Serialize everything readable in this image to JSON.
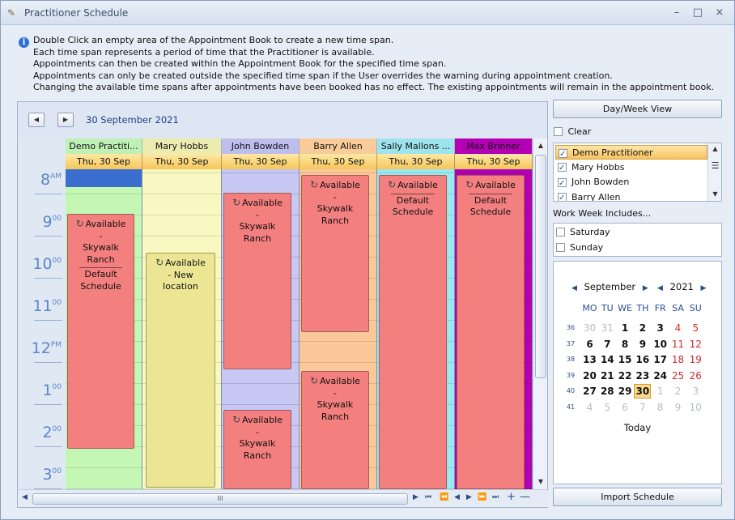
{
  "window": {
    "title": "Practitioner Schedule",
    "controls": [
      "–",
      "□",
      "×"
    ]
  },
  "info": {
    "lines": [
      "Double Click an empty area of the Appointment Book to create a new time span.",
      "Each time span represents a period of time that the Practitioner is available.",
      "Appointments can then be created within the Appointment Book for the specified time span.",
      "Appointments can only be created outside the specified time span if the User overrides the warning during appointment creation.",
      "Changing the available time spans after appointments have been booked has no effect.  The existing appointments will remain in the appointment book."
    ]
  },
  "book": {
    "date": "30 September 2021",
    "times": [
      {
        "h": "8",
        "m": "AM"
      },
      {
        "h": "9",
        "m": "00"
      },
      {
        "h": "10",
        "m": "00"
      },
      {
        "h": "11",
        "m": "00"
      },
      {
        "h": "12",
        "m": "PM"
      },
      {
        "h": "1",
        "m": "00"
      },
      {
        "h": "2",
        "m": "00"
      },
      {
        "h": "3",
        "m": "00"
      }
    ],
    "columns": [
      {
        "name": "Demo Practiti...",
        "date": "Thu, 30 Sep",
        "head_color": "#bff0b4",
        "body_color": "#c4f6b4",
        "line_color": "#a9dc9c",
        "busy_color": "#3a6fd0"
      },
      {
        "name": "Mary Hobbs",
        "date": "Thu, 30 Sep",
        "head_color": "#ecebb0",
        "body_color": "#faf8c2",
        "line_color": "#dedba0",
        "busy_color": ""
      },
      {
        "name": "John Bowden",
        "date": "Thu, 30 Sep",
        "head_color": "#bdbdee",
        "body_color": "#c8c8f4",
        "line_color": "#a9a9dc",
        "busy_color": ""
      },
      {
        "name": "Barry Allen",
        "date": "Thu, 30 Sep",
        "head_color": "#f9cb98",
        "body_color": "#fbc89a",
        "line_color": "#e3b083",
        "busy_color": ""
      },
      {
        "name": "Sally  Mallons ...",
        "date": "Thu, 30 Sep",
        "head_color": "#9ee4ec",
        "body_color": "#9ae8f0",
        "line_color": "#82d2da",
        "busy_color": ""
      },
      {
        "name": "Max Brinner",
        "date": "Thu, 30 Sep",
        "head_color": "#b400b4",
        "body_color": "#b400b4",
        "line_color": "#9a009a",
        "busy_color": ""
      }
    ],
    "appointments": [
      {
        "col": 0,
        "lines": [
          "Available",
          "-",
          "Skywalk",
          "Ranch",
          "Default",
          "Schedule"
        ],
        "style": "red"
      },
      {
        "col": 1,
        "lines": [
          "Available",
          "- New",
          "location"
        ],
        "style": "yellow"
      },
      {
        "col": 2,
        "lines": [
          "Available",
          "-",
          "Skywalk",
          "Ranch"
        ],
        "style": "red"
      },
      {
        "col": 2,
        "lines": [
          "Available",
          "-",
          "Skywalk",
          "Ranch"
        ],
        "style": "red"
      },
      {
        "col": 3,
        "lines": [
          "Available",
          "-",
          "Skywalk",
          "Ranch"
        ],
        "style": "red"
      },
      {
        "col": 3,
        "lines": [
          "Available",
          "-",
          "Skywalk",
          "Ranch"
        ],
        "style": "red"
      },
      {
        "col": 4,
        "lines": [
          "Available",
          "Default",
          "Schedule"
        ],
        "style": "red"
      },
      {
        "col": 5,
        "lines": [
          "Available",
          "Default",
          "Schedule"
        ],
        "style": "red"
      }
    ],
    "hscroll_grip": "III"
  },
  "sidebar": {
    "view_button": "Day/Week View",
    "clear_label": "Clear",
    "clear_checked": false,
    "practitioners": [
      {
        "name": "Demo Practitioner",
        "checked": true,
        "selected": true
      },
      {
        "name": "Mary Hobbs",
        "checked": true,
        "selected": false
      },
      {
        "name": "John Bowden",
        "checked": true,
        "selected": false
      },
      {
        "name": "Barry Allen",
        "checked": true,
        "selected": false
      }
    ],
    "work_week_label": "Work Week Includes...",
    "work_week": [
      {
        "name": "Saturday",
        "checked": false
      },
      {
        "name": "Sunday",
        "checked": false
      }
    ],
    "import_button": "Import Schedule"
  },
  "calendar": {
    "month": "September",
    "year": "2021",
    "dow": [
      "MO",
      "TU",
      "WE",
      "TH",
      "FR",
      "SA",
      "SU"
    ],
    "weeks": [
      {
        "wk": "36",
        "days": [
          {
            "d": "30",
            "other": true
          },
          {
            "d": "31",
            "other": true
          },
          {
            "d": "1"
          },
          {
            "d": "2"
          },
          {
            "d": "3"
          },
          {
            "d": "4",
            "wknd": true
          },
          {
            "d": "5",
            "wknd": true
          }
        ]
      },
      {
        "wk": "37",
        "days": [
          {
            "d": "6"
          },
          {
            "d": "7"
          },
          {
            "d": "8"
          },
          {
            "d": "9"
          },
          {
            "d": "10"
          },
          {
            "d": "11",
            "wknd": true
          },
          {
            "d": "12",
            "wknd": true
          }
        ]
      },
      {
        "wk": "38",
        "days": [
          {
            "d": "13"
          },
          {
            "d": "14"
          },
          {
            "d": "15"
          },
          {
            "d": "16"
          },
          {
            "d": "17"
          },
          {
            "d": "18",
            "wknd": true
          },
          {
            "d": "19",
            "wknd": true
          }
        ]
      },
      {
        "wk": "39",
        "days": [
          {
            "d": "20"
          },
          {
            "d": "21"
          },
          {
            "d": "22"
          },
          {
            "d": "23"
          },
          {
            "d": "24"
          },
          {
            "d": "25",
            "wknd": true
          },
          {
            "d": "26",
            "wknd": true
          }
        ]
      },
      {
        "wk": "40",
        "days": [
          {
            "d": "27"
          },
          {
            "d": "28"
          },
          {
            "d": "29"
          },
          {
            "d": "30",
            "today": true
          },
          {
            "d": "1",
            "other": true
          },
          {
            "d": "2",
            "other": true,
            "wknd": true
          },
          {
            "d": "3",
            "other": true,
            "wknd": true
          }
        ]
      },
      {
        "wk": "41",
        "days": [
          {
            "d": "4",
            "other": true
          },
          {
            "d": "5",
            "other": true
          },
          {
            "d": "6",
            "other": true
          },
          {
            "d": "7",
            "other": true
          },
          {
            "d": "8",
            "other": true
          },
          {
            "d": "9",
            "other": true,
            "wknd": true
          },
          {
            "d": "10",
            "other": true,
            "wknd": true
          }
        ]
      }
    ],
    "today_label": "Today"
  }
}
